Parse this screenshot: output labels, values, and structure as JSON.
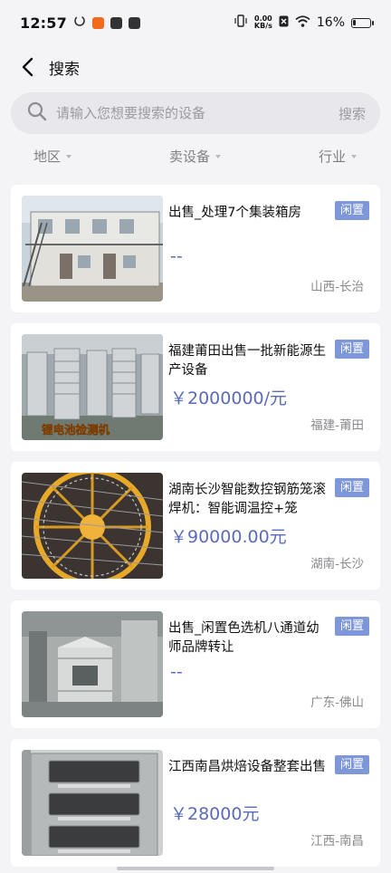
{
  "status_bar": {
    "time": "12:57",
    "net_speed_value": "0.00",
    "net_speed_unit": "KB/s",
    "battery": "16%",
    "battery_level": 0.16
  },
  "header": {
    "title": "搜索"
  },
  "search": {
    "placeholder": "请输入您想要搜索的设备",
    "button_label": "搜索"
  },
  "filters": [
    {
      "label": "地区"
    },
    {
      "label": "卖设备"
    },
    {
      "label": "行业"
    }
  ],
  "listings": [
    {
      "title": "出售_处理7个集装箱房",
      "badge": "闲置",
      "price": "--",
      "location": "山西-长治"
    },
    {
      "title": "福建莆田出售一批新能源生产设备",
      "badge": "闲置",
      "price": "￥2000000/元",
      "location": "福建-莆田",
      "image_caption": "锂电池检测机"
    },
    {
      "title": "湖南长沙智能数控钢筋笼滚焊机：智能调温控+笼",
      "badge": "闲置",
      "price": "￥90000.00元",
      "location": "湖南-长沙"
    },
    {
      "title": "出售_闲置色选机八通道幼师品牌转让",
      "badge": "闲置",
      "price": "--",
      "location": "广东-佛山"
    },
    {
      "title": "江西南昌烘焙设备整套出售",
      "badge": "闲置",
      "price": "￥28000元",
      "location": "江西-南昌"
    }
  ],
  "colors": {
    "accent": "#5b6bb8",
    "badge_bg": "#7e97d9",
    "background": "#f4f4f6"
  }
}
